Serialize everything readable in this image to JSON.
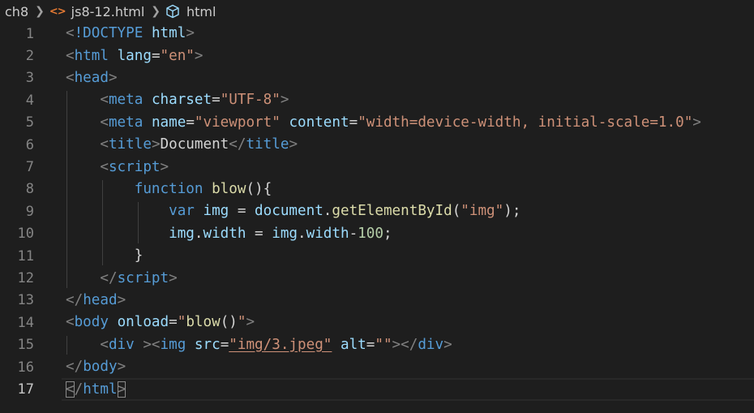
{
  "breadcrumb": {
    "folder": "ch8",
    "file": "js8-12.html",
    "symbol": "html"
  },
  "editor": {
    "line_numbers": [
      "1",
      "2",
      "3",
      "4",
      "5",
      "6",
      "7",
      "8",
      "9",
      "10",
      "11",
      "12",
      "13",
      "14",
      "15",
      "16",
      "17"
    ],
    "current_line": 17,
    "lines": [
      [
        [
          "p",
          "<"
        ],
        [
          "t",
          "!DOCTYPE"
        ],
        [
          "w",
          " "
        ],
        [
          "a",
          "html"
        ],
        [
          "p",
          ">"
        ]
      ],
      [
        [
          "p",
          "<"
        ],
        [
          "t",
          "html"
        ],
        [
          "w",
          " "
        ],
        [
          "a",
          "lang"
        ],
        [
          "w",
          "="
        ],
        [
          "s",
          "\"en\""
        ],
        [
          "p",
          ">"
        ]
      ],
      [
        [
          "p",
          "<"
        ],
        [
          "t",
          "head"
        ],
        [
          "p",
          ">"
        ]
      ],
      [
        [
          "w",
          "    "
        ],
        [
          "p",
          "<"
        ],
        [
          "t",
          "meta"
        ],
        [
          "w",
          " "
        ],
        [
          "a",
          "charset"
        ],
        [
          "w",
          "="
        ],
        [
          "s",
          "\"UTF-8\""
        ],
        [
          "p",
          ">"
        ]
      ],
      [
        [
          "w",
          "    "
        ],
        [
          "p",
          "<"
        ],
        [
          "t",
          "meta"
        ],
        [
          "w",
          " "
        ],
        [
          "a",
          "name"
        ],
        [
          "w",
          "="
        ],
        [
          "s",
          "\"viewport\""
        ],
        [
          "w",
          " "
        ],
        [
          "a",
          "content"
        ],
        [
          "w",
          "="
        ],
        [
          "s",
          "\"width=device-width, initial-scale=1.0\""
        ],
        [
          "p",
          ">"
        ]
      ],
      [
        [
          "w",
          "    "
        ],
        [
          "p",
          "<"
        ],
        [
          "t",
          "title"
        ],
        [
          "p",
          ">"
        ],
        [
          "w",
          "Document"
        ],
        [
          "p",
          "</"
        ],
        [
          "t",
          "title"
        ],
        [
          "p",
          ">"
        ]
      ],
      [
        [
          "w",
          "    "
        ],
        [
          "p",
          "<"
        ],
        [
          "t",
          "script"
        ],
        [
          "p",
          ">"
        ]
      ],
      [
        [
          "w",
          "        "
        ],
        [
          "k",
          "function"
        ],
        [
          "w",
          " "
        ],
        [
          "f",
          "blow"
        ],
        [
          "w",
          "(){"
        ]
      ],
      [
        [
          "w",
          "            "
        ],
        [
          "k",
          "var"
        ],
        [
          "w",
          " "
        ],
        [
          "a",
          "img"
        ],
        [
          "w",
          " = "
        ],
        [
          "a",
          "document"
        ],
        [
          "w",
          "."
        ],
        [
          "f",
          "getElementById"
        ],
        [
          "w",
          "("
        ],
        [
          "s",
          "\"img\""
        ],
        [
          "w",
          ");"
        ]
      ],
      [
        [
          "w",
          "            "
        ],
        [
          "a",
          "img"
        ],
        [
          "w",
          "."
        ],
        [
          "a",
          "width"
        ],
        [
          "w",
          " = "
        ],
        [
          "a",
          "img"
        ],
        [
          "w",
          "."
        ],
        [
          "a",
          "width"
        ],
        [
          "w",
          "-"
        ],
        [
          "n",
          "100"
        ],
        [
          "w",
          ";"
        ]
      ],
      [
        [
          "w",
          "        "
        ],
        [
          "w",
          "}"
        ]
      ],
      [
        [
          "w",
          "    "
        ],
        [
          "p",
          "</"
        ],
        [
          "t",
          "script"
        ],
        [
          "p",
          ">"
        ]
      ],
      [
        [
          "p",
          "</"
        ],
        [
          "t",
          "head"
        ],
        [
          "p",
          ">"
        ]
      ],
      [
        [
          "p",
          "<"
        ],
        [
          "t",
          "body"
        ],
        [
          "w",
          " "
        ],
        [
          "a",
          "onload"
        ],
        [
          "w",
          "="
        ],
        [
          "s",
          "\""
        ],
        [
          "f",
          "blow"
        ],
        [
          "w",
          "()"
        ],
        [
          "s",
          "\""
        ],
        [
          "p",
          ">"
        ]
      ],
      [
        [
          "w",
          "    "
        ],
        [
          "p",
          "<"
        ],
        [
          "t",
          "div"
        ],
        [
          "w",
          " "
        ],
        [
          "p",
          "><"
        ],
        [
          "t",
          "img"
        ],
        [
          "w",
          " "
        ],
        [
          "a",
          "src"
        ],
        [
          "w",
          "="
        ],
        [
          "su",
          "\"img/3.jpeg\""
        ],
        [
          "w",
          " "
        ],
        [
          "a",
          "alt"
        ],
        [
          "w",
          "="
        ],
        [
          "s",
          "\"\""
        ],
        [
          "p",
          "></"
        ],
        [
          "t",
          "div"
        ],
        [
          "p",
          ">"
        ]
      ],
      [
        [
          "p",
          "</"
        ],
        [
          "t",
          "body"
        ],
        [
          "p",
          ">"
        ]
      ],
      [
        [
          "pb",
          "<"
        ],
        [
          "p",
          "/"
        ],
        [
          "t",
          "html"
        ],
        [
          "pb",
          ">"
        ]
      ]
    ]
  },
  "colors": {
    "background": "#1e1e1e",
    "tag": "#569cd6",
    "attribute": "#9cdcfe",
    "string": "#ce9178",
    "function": "#dcdcaa",
    "number": "#b5cea8",
    "punctuation": "#808080",
    "file_icon": "#e37933"
  }
}
